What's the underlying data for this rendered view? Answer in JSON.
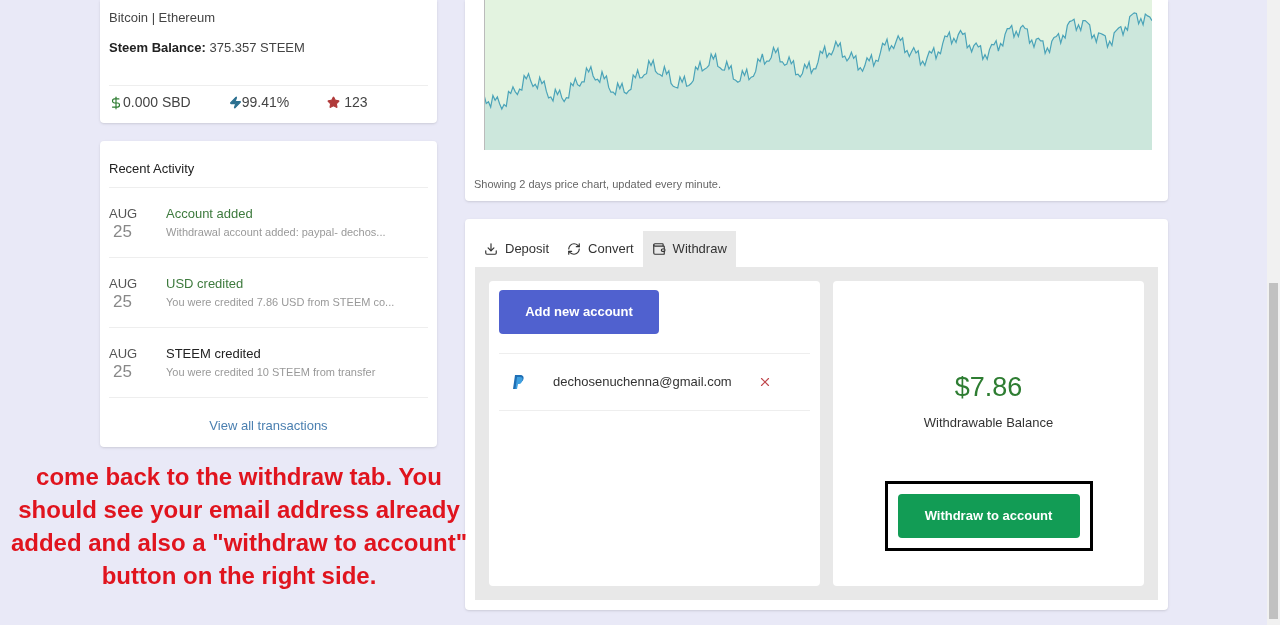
{
  "profile": {
    "interests": "Bitcoin | Ethereum",
    "balance_label": "Steem Balance:",
    "balance_value": "375.357 STEEM",
    "sbd": "0.000 SBD",
    "voting_power": "99.41%",
    "reputation": "123"
  },
  "recent_activity": {
    "title": "Recent Activity",
    "items": [
      {
        "month": "AUG",
        "day": "25",
        "title": "Account added",
        "detail": "Withdrawal account added: paypal- dechos...",
        "kind": "credit"
      },
      {
        "month": "AUG",
        "day": "25",
        "title": "USD credited",
        "detail": "You were credited 7.86 USD from STEEM co...",
        "kind": "credit"
      },
      {
        "month": "AUG",
        "day": "25",
        "title": "STEEM credited",
        "detail": "You were credited 10 STEEM from transfer",
        "kind": "neutral"
      }
    ],
    "link": "View all transactions"
  },
  "price_chart": {
    "caption": "Showing 2 days price chart, updated every minute."
  },
  "tabs": [
    {
      "label": "Deposit",
      "kind": "deposit",
      "selected": false
    },
    {
      "label": "Convert",
      "kind": "convert",
      "selected": false
    },
    {
      "label": "Withdraw",
      "kind": "withdraw",
      "selected": true
    }
  ],
  "withdraw": {
    "add_button": "Add new account",
    "accounts": [
      {
        "email": "dechosenuchenna@gmail.com"
      }
    ],
    "amount": "$7.86",
    "amount_label": "Withdrawable Balance",
    "withdraw_button": "Withdraw to account",
    "highlighted": true
  },
  "annotation": "come back to the withdraw tab. You should see your email address already added and also a \"withdraw to account\" button on the right side."
}
